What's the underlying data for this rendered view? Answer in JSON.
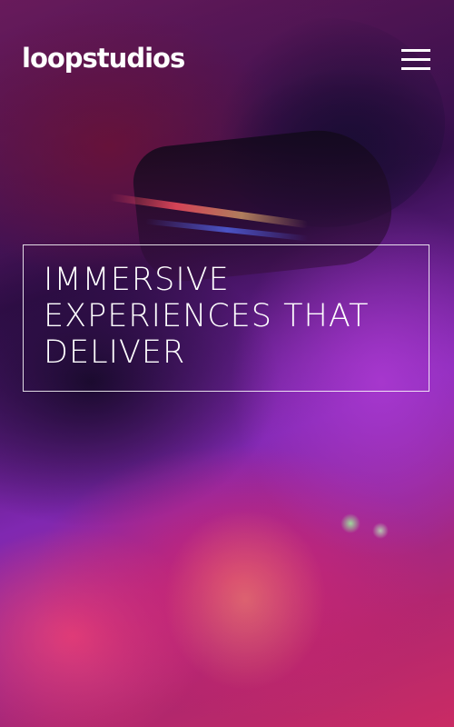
{
  "header": {
    "logo_text": "loopstudios",
    "menu_icon": "hamburger-menu-icon"
  },
  "hero": {
    "headline": "IMMERSIVE EXPERIENCES THAT DELIVER",
    "background": "photo of a person wearing a VR headset with magenta/purple tint",
    "accent_colors": [
      "#3b1056",
      "#8a2bbf",
      "#e0306f"
    ]
  }
}
